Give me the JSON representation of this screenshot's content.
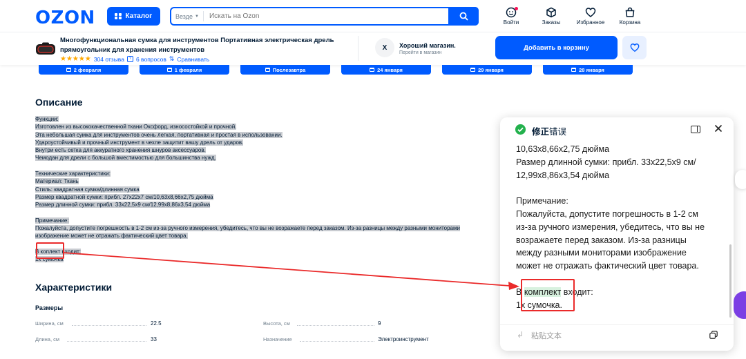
{
  "header": {
    "logo": "OZON",
    "catalog_label": "Каталог",
    "search_scope": "Везде",
    "search_placeholder": "Искать на Ozon",
    "nav": [
      {
        "label": "Войти",
        "icon": "face-icon"
      },
      {
        "label": "Заказы",
        "icon": "box-icon"
      },
      {
        "label": "Избранное",
        "icon": "heart-icon"
      },
      {
        "label": "Корзина",
        "icon": "cart-icon"
      }
    ]
  },
  "product": {
    "title_line1": "Многофункциональная сумка для инструментов Портативная электрическая дрель",
    "title_line2": "прямоугольник для хранения инструментов",
    "stars": "★★★★★",
    "reviews": "304 отзыва",
    "questions": "6 вопросов",
    "compare": "Сравнивать",
    "shop_initial": "X",
    "shop_name": "Хороший магазин.",
    "shop_link": "Перейти в магазин",
    "add_to_cart": "Добавить в корзину"
  },
  "delivery_dates": [
    "2 февраля",
    "1 февраля",
    "Послезавтра",
    "24 января",
    "29 января",
    "28 января"
  ],
  "description": {
    "heading": "Описание",
    "lines": [
      "Функции:",
      "Изготовлен из высококачественной ткани Оксфорд, износостойкой и прочной.",
      "Эта небольшая сумка для инструментов очень легкая, портативная и простая в использовании.",
      "Удароустойчивый и прочный инструмент в чехле защитит вашу дрель от ударов.",
      "Внутри есть сетка для аккуратного хранения шнуров аксессуаров.",
      "Чемодан для дрели с большой вместимостью для большинства нужд.",
      "",
      "Технические характеристики:",
      "Материал: Ткань",
      "Стиль: квадратная сумка/длинная сумка",
      "Размер квадратной сумки: прибл. 27x22x7 см/10,63x8,66x2,75 дюйма",
      "Размер длинной сумки: прибл. 33x22,5x9 см/12,99x8,86x3,54 дюйма",
      "",
      "Примечание:",
      "Пожалуйста, допустите погрешность в 1-2 см из-за ручного измерения, убедитесь, что вы не возражаете перед заказом. Из-за разницы между разными мониторами",
      "изображение может не отражать фактический цвет товара.",
      "",
      "В коплект входит:",
      "1x сумочка"
    ]
  },
  "characteristics": {
    "heading": "Характеристики",
    "section": "Размеры",
    "rows": [
      {
        "key": "Ширина, см",
        "value": "22.5"
      },
      {
        "key": "Высота, см",
        "value": "9"
      },
      {
        "key": "Длина, см",
        "value": "33"
      },
      {
        "key": "Назначение",
        "value": "Электроинструмент"
      }
    ]
  },
  "panel": {
    "title_bold": "修正",
    "title_rest": "错误",
    "lines": [
      "10,63x8,66x2,75 дюйма",
      "Размер длинной сумки: прибл. 33x22,5x9 см/",
      "12,99x8,86x3,54 дюйма",
      "",
      "Примечание:",
      "Пожалуйста, допустите погрешность в 1-2 см",
      "из-за ручного измерения, убедитесь, что вы не",
      "возражаете перед заказом. Из-за разницы",
      "между разными мониторами изображение",
      "может не отражать фактический цвет товара.",
      ""
    ],
    "fix_prefix": "В ",
    "fix_word": "комплект",
    "fix_suffix": " входит:",
    "last_line": "1x сумочка.",
    "paste_label": "粘贴文本"
  },
  "colors": {
    "brand": "#005bff",
    "annotation": "#ea2a2a",
    "success": "#23b14d",
    "highlight": "#d8f1df"
  }
}
